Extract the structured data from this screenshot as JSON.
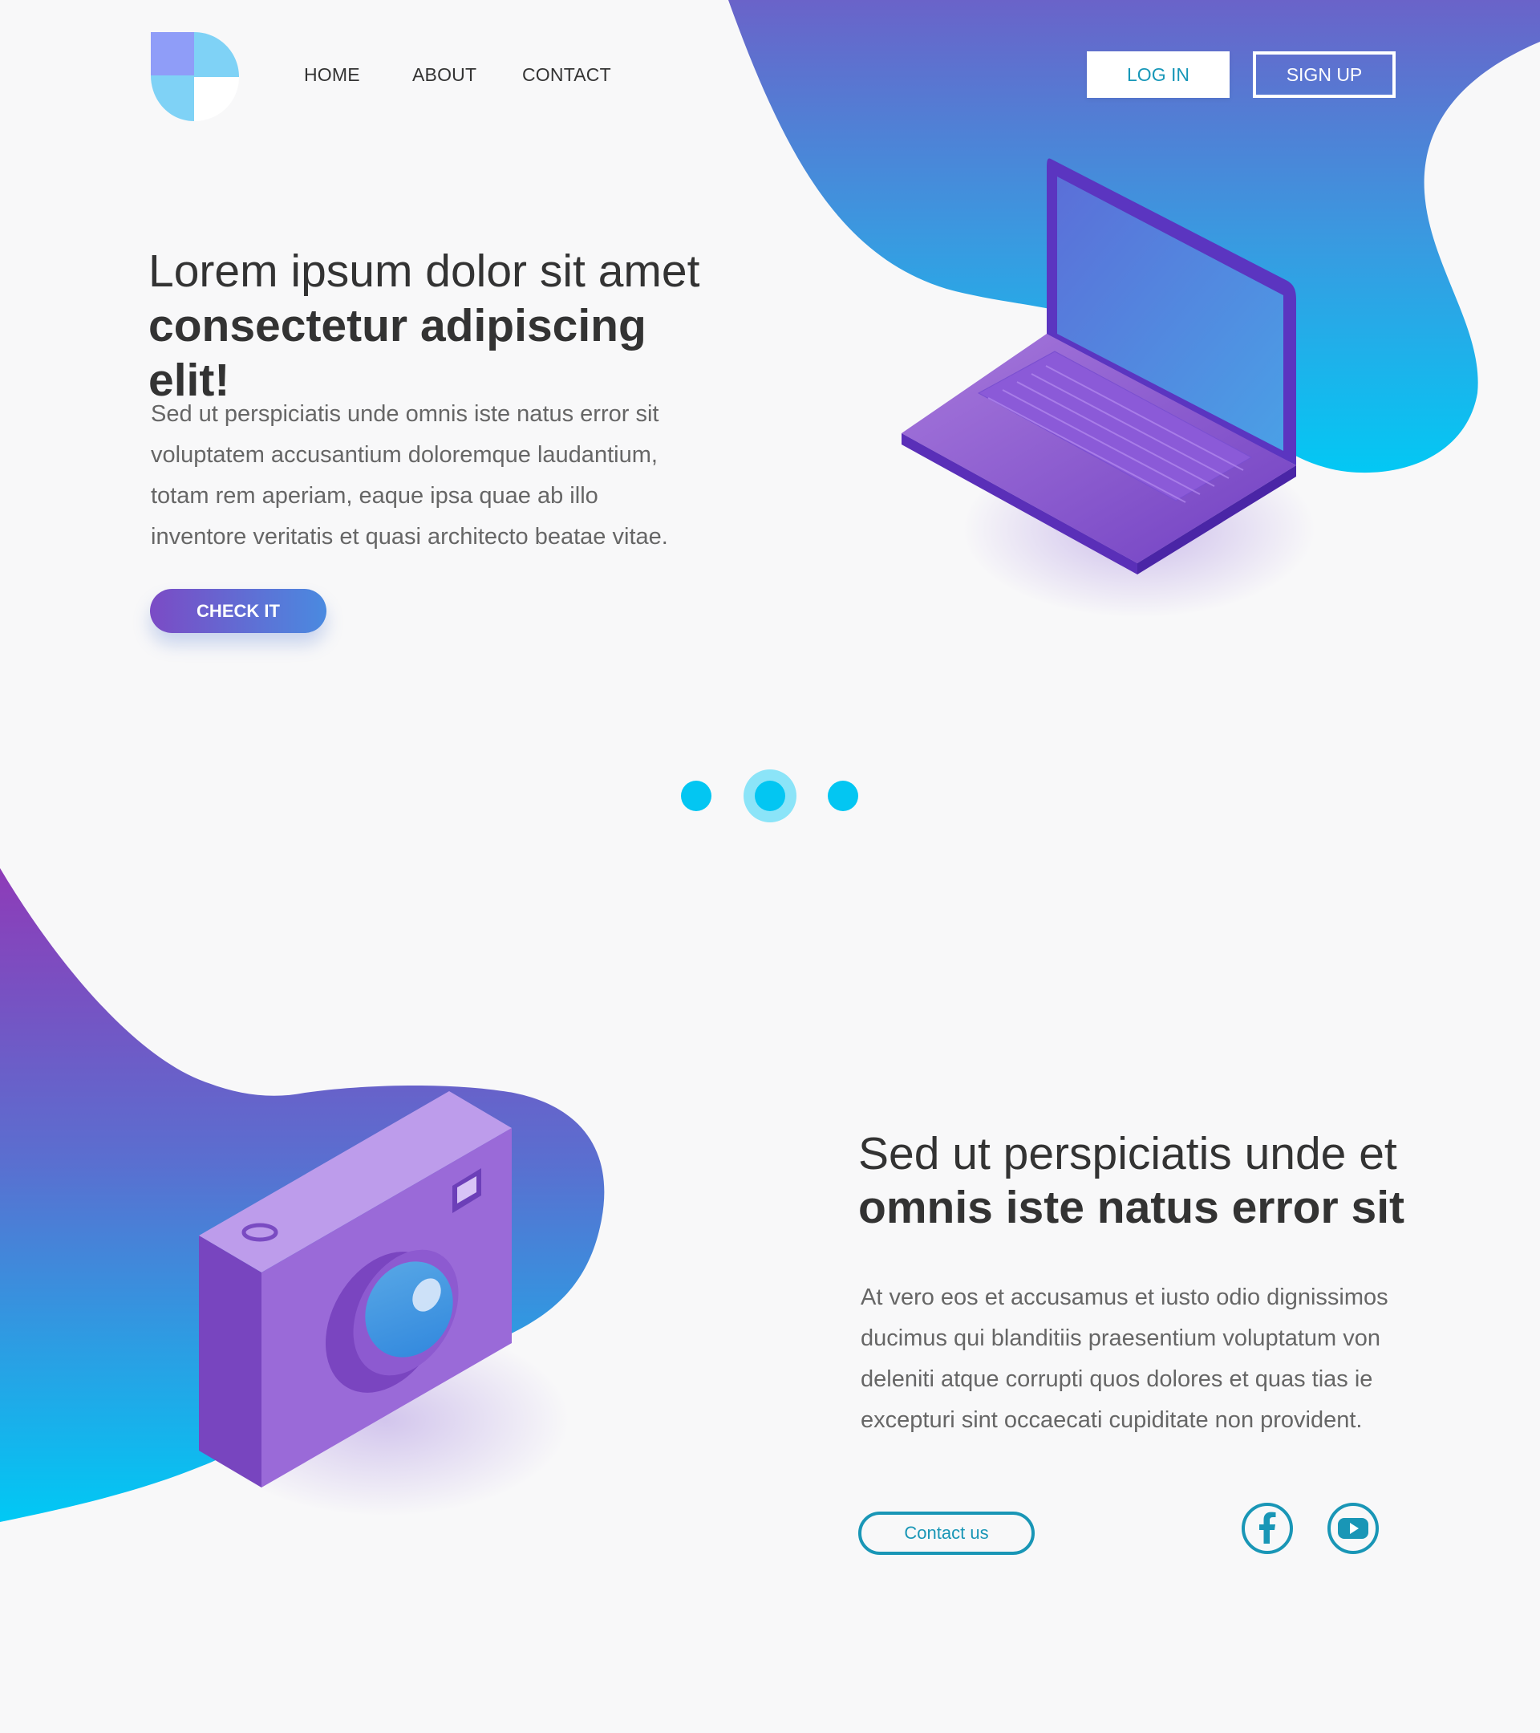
{
  "brand": {
    "logo_name": "brand-logo"
  },
  "nav": {
    "items": [
      "HOME",
      "ABOUT",
      "CONTACT"
    ]
  },
  "auth": {
    "login_label": "LOG IN",
    "signup_label": "SIGN UP"
  },
  "hero": {
    "title_line1": "Lorem ipsum dolor sit amet",
    "title_line2": "consectetur adipiscing elit!",
    "paragraph": [
      "Sed ut perspiciatis unde omnis iste natus error sit",
      "voluptatem accusantium doloremque laudantium,",
      "totam rem aperiam, eaque ipsa quae ab illo",
      "inventore veritatis et quasi architecto beatae vitae."
    ],
    "cta_label": "CHECK IT",
    "illustration": "laptop-illustration"
  },
  "carousel": {
    "count": 3,
    "active_index": 1
  },
  "section2": {
    "title_line1": "Sed ut perspiciatis unde et",
    "title_line2": "omnis iste natus error sit",
    "paragraph": [
      "At vero eos et accusamus et iusto odio dignissimos",
      "ducimus qui blanditiis praesentium voluptatum von",
      "deleniti atque corrupti quos dolores et quas tias ie",
      "excepturi sint occaecati cupiditate non provident."
    ],
    "contact_label": "Contact us",
    "illustration": "camera-illustration",
    "social": [
      "facebook-icon",
      "youtube-icon"
    ]
  },
  "colors": {
    "accent_blue": "#03c6f2",
    "accent_purple": "#7b4bc5",
    "link_teal": "#1797b8",
    "background": "#f8f8f9"
  }
}
